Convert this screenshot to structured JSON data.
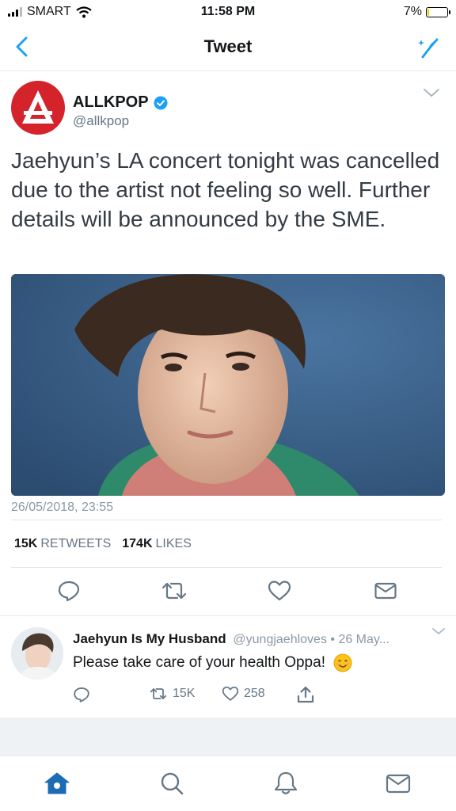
{
  "status_bar": {
    "carrier": "SMART",
    "time": "11:58 PM",
    "battery": "7%",
    "battery_level": 0.07
  },
  "nav": {
    "title": "Tweet",
    "back_icon": "chevron-left-icon",
    "compose_icon": "sparkle-compose-icon"
  },
  "tweet": {
    "author_name": "ALLKPOP",
    "author_handle": "@allkpop",
    "verified": true,
    "text": "Jaehyun’s LA concert tonight was cancelled due to the artist not feeling so well. Further details will be announced by the SME.",
    "timestamp": "26/05/2018, 23:55",
    "retweets_count": "15K",
    "retweets_label": "RETWEETS",
    "likes_count": "174K",
    "likes_label": "LIKES"
  },
  "reply": {
    "name": "Jaehyun Is My Husband",
    "meta": "@yungjaehloves • 26 May...",
    "text": "Please take care of your health Oppa!",
    "retweets": "15K",
    "likes": "258"
  },
  "colors": {
    "accent": "#1da1f2",
    "allkpop_red": "#d4232b",
    "tab_active": "#1c6bb5"
  }
}
